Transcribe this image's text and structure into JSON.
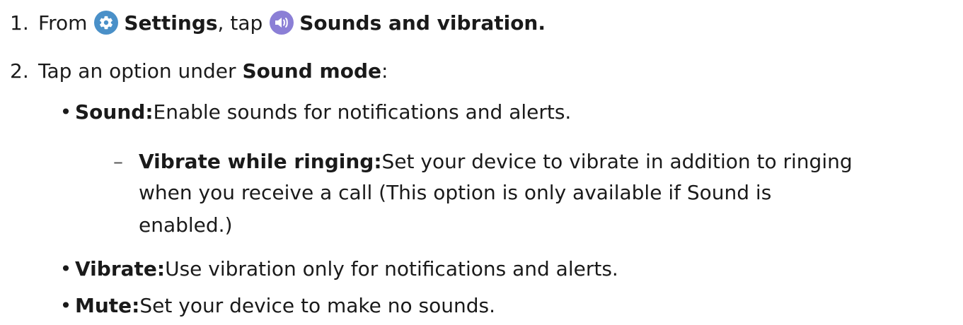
{
  "step1": {
    "number": "1.",
    "from_text": "From",
    "settings_icon": "gear-icon",
    "settings_label": "Settings",
    "tap_text": ", tap",
    "sound_icon": "speaker-icon",
    "sounds_label": "Sounds and vibration."
  },
  "step2": {
    "number": "2.",
    "text": "Tap an option under",
    "bold": "Sound mode",
    "colon": ":"
  },
  "options": [
    {
      "label": "Sound:",
      "text": " Enable sounds for notifications and alerts."
    },
    {
      "label": "Vibrate:",
      "text": " Use vibration only for notifications and alerts."
    },
    {
      "label": "Mute:",
      "text": " Set your device to make no sounds."
    }
  ],
  "sub_option": {
    "label": "Vibrate while ringing:",
    "line1": " Set your device to vibrate in addition to ringing",
    "line2": "when you receive a call (This option is only available if Sound is",
    "line3": "enabled.)"
  },
  "colors": {
    "settings_icon_bg": "#4a90c8",
    "sound_icon_bg": "#8b7fd6"
  }
}
